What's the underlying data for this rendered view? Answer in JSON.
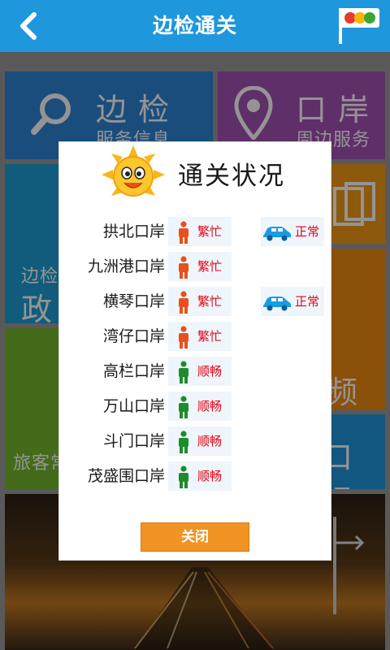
{
  "header": {
    "title": "边检通关",
    "back_icon": "back-chevron-icon",
    "signal_icon": "traffic-light-flag-icon"
  },
  "background_tiles": {
    "info": {
      "title": "边检",
      "subtitle": "服务信息",
      "icon": "search-icon"
    },
    "nearby": {
      "title": "口岸",
      "subtitle": "周边服务",
      "icon": "location-pin-icon"
    },
    "policy": {
      "title_a": "边检",
      "title_b": "政"
    },
    "video": {
      "text": "频"
    },
    "green": {
      "text": "旅客常"
    },
    "report": {
      "text": "口报"
    }
  },
  "dialog": {
    "title": "通关状况",
    "mascot_icon": "sun-mascot-icon",
    "rows": [
      {
        "port": "拱北口岸",
        "status": "繁忙",
        "level": "busy",
        "car": "正常"
      },
      {
        "port": "九洲港口岸",
        "status": "繁忙",
        "level": "busy",
        "car": ""
      },
      {
        "port": "横琴口岸",
        "status": "繁忙",
        "level": "busy",
        "car": "正常"
      },
      {
        "port": "湾仔口岸",
        "status": "繁忙",
        "level": "busy",
        "car": ""
      },
      {
        "port": "高栏口岸",
        "status": "顺畅",
        "level": "smooth",
        "car": ""
      },
      {
        "port": "万山口岸",
        "status": "顺畅",
        "level": "smooth",
        "car": ""
      },
      {
        "port": "斗门口岸",
        "status": "顺畅",
        "level": "smooth",
        "car": ""
      },
      {
        "port": "茂盛围口岸",
        "status": "顺畅",
        "level": "smooth",
        "car": ""
      }
    ],
    "close_label": "关闭"
  },
  "colors": {
    "header": "#1f97dd",
    "busy_person": "#e8501c",
    "smooth_person": "#1e8c2a",
    "status_text": "#e60012",
    "car_icon": "#1a9be0",
    "close_button": "#f19424"
  }
}
